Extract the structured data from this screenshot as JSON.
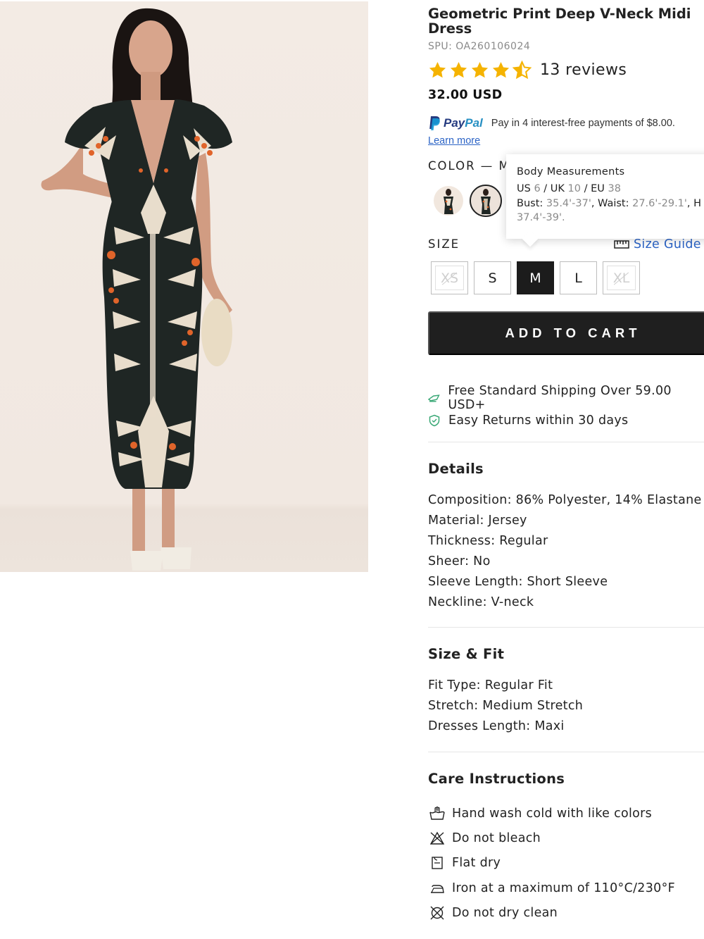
{
  "product": {
    "title": "Geometric Print Deep V-Neck Midi Dress",
    "spu": "SPU: OA260106024",
    "rating": 4.5,
    "reviews": "13 reviews",
    "price": "32.00 USD"
  },
  "paypal": {
    "logo_pay": "Pay",
    "logo_pal": "Pal",
    "message": "Pay in 4 interest-free payments of $8.00.",
    "learn_more": "Learn more"
  },
  "color": {
    "label": "COLOR — M"
  },
  "tooltip": {
    "title": "Body Measurements",
    "us_label": "US",
    "us": "6",
    "uk_label": "/ UK",
    "uk": "10",
    "eu_label": "/ EU",
    "eu": "38",
    "bust_label": "Bust:",
    "bust": "35.4'-37'",
    "waist_label": ", Waist:",
    "waist": "27.6'-29.1'",
    "hip_label": ", H",
    "hip": "37.4'-39'."
  },
  "size": {
    "label": "SIZE",
    "guide": "Size Guide",
    "options": [
      "XS",
      "S",
      "M",
      "L",
      "XL"
    ],
    "selected": "M",
    "unavailable": [
      "XS",
      "XL"
    ]
  },
  "cart": {
    "label": "ADD TO CART"
  },
  "perks": {
    "shipping": "Free Standard Shipping Over 59.00 USD+",
    "returns": "Easy Returns within 30 days"
  },
  "details": {
    "title": "Details",
    "items": [
      "Composition: 86% Polyester, 14% Elastane",
      "Material: Jersey",
      "Thickness: Regular",
      "Sheer: No",
      "Sleeve Length: Short Sleeve",
      "Neckline: V-neck"
    ]
  },
  "fit": {
    "title": "Size & Fit",
    "items": [
      "Fit Type: Regular Fit",
      "Stretch: Medium Stretch",
      "Dresses Length: Maxi"
    ]
  },
  "care": {
    "title": "Care Instructions",
    "items": [
      {
        "icon": "hand-wash-icon",
        "text": "Hand wash cold with like colors"
      },
      {
        "icon": "no-bleach-icon",
        "text": "Do not bleach"
      },
      {
        "icon": "flat-dry-icon",
        "text": "Flat dry"
      },
      {
        "icon": "iron-icon",
        "text": "Iron at a maximum of 110°C/230°F"
      },
      {
        "icon": "no-dry-clean-icon",
        "text": "Do not dry clean"
      }
    ]
  },
  "colors": {
    "star": "#f5b301",
    "link": "#2c64c6",
    "cart_bg": "#1f1f1f",
    "accent_green": "#3aa876"
  }
}
